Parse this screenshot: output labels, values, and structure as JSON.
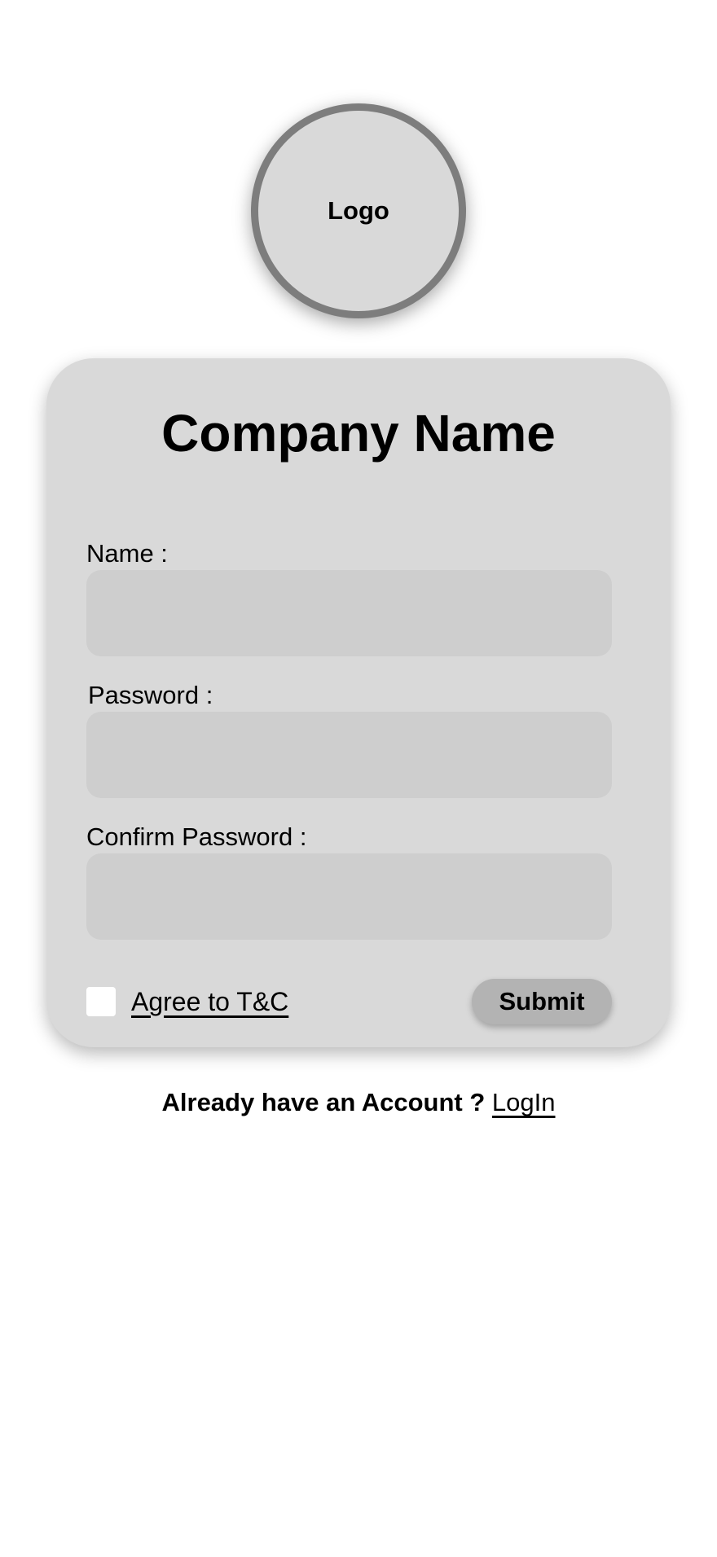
{
  "logo": {
    "label": "Logo"
  },
  "form": {
    "title": "Company Name",
    "name_label": "Name :",
    "name_value": "",
    "password_label": "Password :",
    "password_value": "",
    "confirm_label": "Confirm Password :",
    "confirm_value": "",
    "terms_label": "Agree to T&C",
    "terms_checked": false,
    "submit_label": "Submit"
  },
  "footer": {
    "question": "Already have an Account ?",
    "link_label": "LogIn"
  },
  "colors": {
    "card_bg": "#d9d9d9",
    "field_bg": "#cecece",
    "logo_border": "#7d7d7d",
    "button_bg": "#b3b3b3"
  }
}
